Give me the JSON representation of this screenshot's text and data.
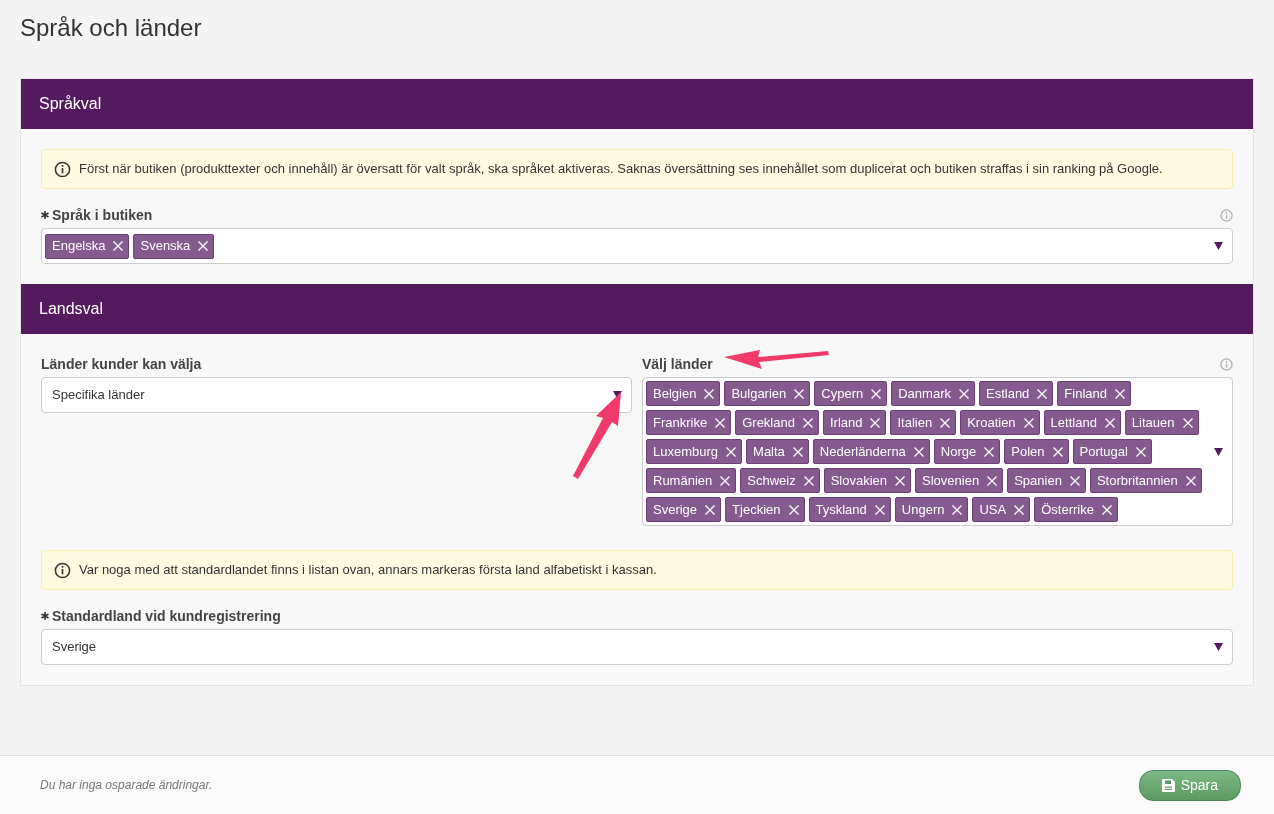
{
  "page_title": "Språk och länder",
  "sections": [
    {
      "title": "Språkval",
      "notice": "Först när butiken (produkttexter och innehåll) är översatt för valt språk, ska språket aktiveras. Saknas översättning ses innehållet som duplicerat och butiken straffas i sin ranking på Google.",
      "fields": [
        {
          "kind": "multiselect",
          "label": "Språk i butiken",
          "required": true,
          "info": true,
          "tags": [
            "Engelska",
            "Svenska"
          ]
        }
      ]
    },
    {
      "title": "Landsval",
      "columns": [
        {
          "kind": "select",
          "label": "Länder kunder kan välja",
          "required": false,
          "info": false,
          "value": "Specifika länder"
        },
        {
          "kind": "multiselect",
          "label": "Välj länder",
          "required": false,
          "info": true,
          "tags": [
            "Belgien",
            "Bulgarien",
            "Cypern",
            "Danmark",
            "Estland",
            "Finland",
            "Frankrike",
            "Grekland",
            "Irland",
            "Italien",
            "Kroatien",
            "Lettland",
            "Litauen",
            "Luxemburg",
            "Malta",
            "Nederländerna",
            "Norge",
            "Polen",
            "Portugal",
            "Rumänien",
            "Schweiz",
            "Slovakien",
            "Slovenien",
            "Spanien",
            "Storbritannien",
            "Sverige",
            "Tjeckien",
            "Tyskland",
            "Ungern",
            "USA",
            "Österrike"
          ]
        }
      ],
      "notice": "Var noga med att standardlandet finns i listan ovan, annars markeras första land alfabetiskt i kassan.",
      "fields": [
        {
          "kind": "select",
          "label": "Standardland vid kundregistrering",
          "required": true,
          "info": false,
          "value": "Sverige"
        }
      ]
    }
  ],
  "footer": {
    "status": "Du har inga osparade ändringar.",
    "save_button": "Spara"
  }
}
